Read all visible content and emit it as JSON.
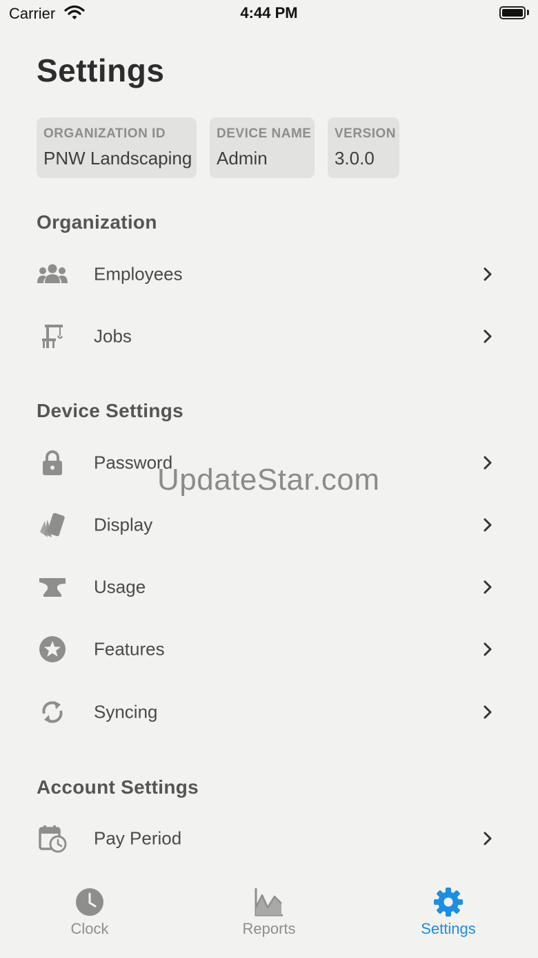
{
  "status_bar": {
    "carrier": "Carrier",
    "time": "4:44 PM"
  },
  "page": {
    "title": "Settings"
  },
  "info_cards": [
    {
      "label": "ORGANIZATION ID",
      "value": "PNW Landscaping"
    },
    {
      "label": "DEVICE NAME",
      "value": "Admin"
    },
    {
      "label": "VERSION",
      "value": "3.0.0"
    }
  ],
  "sections": {
    "organization": {
      "heading": "Organization",
      "items": [
        {
          "label": "Employees",
          "icon": "users-icon"
        },
        {
          "label": "Jobs",
          "icon": "crane-icon"
        }
      ]
    },
    "device_settings": {
      "heading": "Device Settings",
      "items": [
        {
          "label": "Password",
          "icon": "lock-icon"
        },
        {
          "label": "Display",
          "icon": "swatch-icon"
        },
        {
          "label": "Usage",
          "icon": "anvil-icon"
        },
        {
          "label": "Features",
          "icon": "star-circle-icon"
        },
        {
          "label": "Syncing",
          "icon": "sync-icon"
        }
      ]
    },
    "account_settings": {
      "heading": "Account Settings",
      "items": [
        {
          "label": "Pay Period",
          "icon": "calendar-clock-icon"
        }
      ]
    }
  },
  "watermark": "UpdateStar.com",
  "tab_bar": {
    "tabs": [
      {
        "label": "Clock",
        "icon": "clock-icon"
      },
      {
        "label": "Reports",
        "icon": "chart-icon"
      },
      {
        "label": "Settings",
        "icon": "gear-icon",
        "active": true
      }
    ]
  },
  "colors": {
    "background": "#f2f2f1",
    "card": "#e2e2e0",
    "accent": "#1c8fe3",
    "icon": "#8e8e8c"
  }
}
